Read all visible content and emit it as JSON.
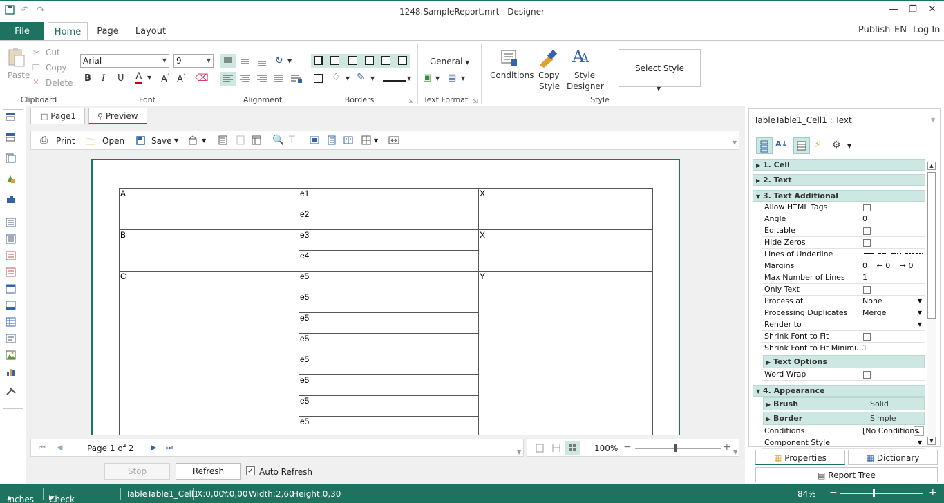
{
  "window": {
    "title": "1248.SampleReport.mrt - Designer"
  },
  "tabs": {
    "file": "File",
    "items": [
      "Home",
      "Page",
      "Layout"
    ],
    "active": "Home"
  },
  "top_right": {
    "publish": "Publish",
    "lang": "EN",
    "login": "Log In"
  },
  "ribbon": {
    "clipboard": {
      "label": "Clipboard",
      "paste": "Paste",
      "cut": "Cut",
      "copy": "Copy",
      "delete": "Delete"
    },
    "font": {
      "label": "Font",
      "family": "Arial",
      "size": "9"
    },
    "alignment": {
      "label": "Alignment"
    },
    "borders": {
      "label": "Borders"
    },
    "text_format": {
      "label": "Text Format",
      "format": "General"
    },
    "style": {
      "label": "Style",
      "conditions": "Conditions",
      "copy_style_1": "Copy",
      "copy_style_2": "Style",
      "style_designer_1": "Style",
      "style_designer_2": "Designer",
      "select_style": "Select Style"
    }
  },
  "doc_tabs": {
    "page1": "Page1",
    "preview": "Preview"
  },
  "preview_toolbar": {
    "print": "Print",
    "open": "Open",
    "save": "Save"
  },
  "table": {
    "col1": [
      "A",
      "B",
      "C"
    ],
    "col2": [
      "e1",
      "e2",
      "e3",
      "e4",
      "e5",
      "e5",
      "e5",
      "e5",
      "e5",
      "e5",
      "e5",
      "e5"
    ],
    "col3": [
      "X",
      "X",
      "Y"
    ]
  },
  "nav": {
    "page_info": "Page 1 of 2",
    "zoom": "100%"
  },
  "preview_actions": {
    "stop": "Stop",
    "refresh": "Refresh",
    "auto_refresh": "Auto Refresh",
    "auto_refresh_checked": true
  },
  "properties": {
    "header": "TableTable1_Cell1 : Text",
    "categories": {
      "cell": "1. Cell",
      "text": "2. Text",
      "text_additional": "3. Text  Additional",
      "appearance": "4. Appearance"
    },
    "rows": [
      {
        "name": "Allow HTML Tags",
        "value": "",
        "type": "check"
      },
      {
        "name": "Angle",
        "value": "0",
        "type": "text"
      },
      {
        "name": "Editable",
        "value": "",
        "type": "check"
      },
      {
        "name": "Hide Zeros",
        "value": "",
        "type": "check"
      },
      {
        "name": "Lines of Underline",
        "value": "",
        "type": "lines"
      },
      {
        "name": "Margins",
        "value": "0",
        "type": "margins"
      },
      {
        "name": "Max Number of Lines",
        "value": "1",
        "type": "text"
      },
      {
        "name": "Only Text",
        "value": "",
        "type": "check"
      },
      {
        "name": "Process at",
        "value": "None",
        "type": "dropdown"
      },
      {
        "name": "Processing Duplicates",
        "value": "Merge",
        "type": "dropdown"
      },
      {
        "name": "Render to",
        "value": "",
        "type": "dropdown"
      },
      {
        "name": "Shrink Font to Fit",
        "value": "",
        "type": "check"
      },
      {
        "name": "Shrink Font to Fit Minimu...",
        "value": "1",
        "type": "text"
      }
    ],
    "margins": [
      "0",
      "0",
      "0"
    ],
    "text_options": "Text Options",
    "word_wrap": "Word Wrap",
    "brush": {
      "name": "Brush",
      "value": "Solid"
    },
    "border": {
      "name": "Border",
      "value": "Simple"
    },
    "conditions": {
      "name": "Conditions",
      "value": "[No Conditions"
    },
    "component_style": {
      "name": "Component Style",
      "value": ""
    },
    "tab_properties": "Properties",
    "tab_dictionary": "Dictionary",
    "report_tree": "Report Tree"
  },
  "status": {
    "units": "Inches",
    "check": "Check for Issues",
    "component": "TableTable1_Cell1",
    "x": "X:0,00",
    "y": "Y:0,00",
    "width": "Width:2,60",
    "height": "Height:0,30",
    "zoom": "84%"
  },
  "colors": {
    "accent": "#1e7260",
    "highlight": "#cde8e2"
  }
}
